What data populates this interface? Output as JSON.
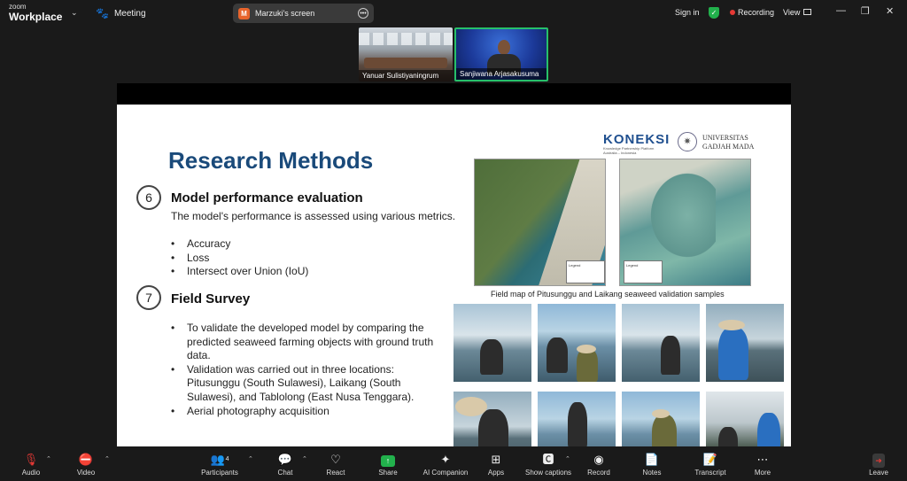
{
  "app": {
    "brand_small": "zoom",
    "brand_big": "Workplace",
    "meeting_label": "Meeting",
    "screen_share_label": "Marzuki's screen",
    "screen_share_avatar": "M",
    "sign_in": "Sign in",
    "recording": "Recording",
    "view": "View"
  },
  "participants": [
    {
      "name": "Yanuar Sulistiyaningrum"
    },
    {
      "name": "Sanjiwana Arjasakusuma"
    }
  ],
  "slide": {
    "title": "Research Methods",
    "logo_koneksi": "KONEKSI",
    "logo_koneksi_sub": "Knowledge Partnership Platform Australia – Indonesia",
    "logo_ugm_line1": "UNIVERSITAS",
    "logo_ugm_line2": "GADJAH MADA",
    "section6": {
      "number": "6",
      "heading": "Model performance evaluation",
      "text": "The model's performance is assessed using various metrics.",
      "bullets": [
        "Accuracy",
        "Loss",
        "Intersect over Union (IoU)"
      ]
    },
    "section7": {
      "number": "7",
      "heading": "Field Survey",
      "bullets": [
        "To validate the developed model by comparing the predicted seaweed farming objects with ground truth data.",
        "Validation was carried out in three locations: Pitusunggu (South Sulawesi), Laikang (South Sulawesi), and Tablolong (East Nusa Tenggara).",
        "Aerial photography acquisition"
      ]
    },
    "map_caption": "Field map of Pitusunggu and Laikang seaweed validation samples",
    "legend_title": "Legend"
  },
  "toolbar": {
    "audio": "Audio",
    "video": "Video",
    "participants": "Participants",
    "participants_count": "4",
    "chat": "Chat",
    "react": "React",
    "share": "Share",
    "ai_companion": "AI Companion",
    "apps": "Apps",
    "show_captions": "Show captions",
    "record": "Record",
    "notes": "Notes",
    "transcript": "Transcript",
    "more": "More",
    "leave": "Leave"
  },
  "colors": {
    "accent_green": "#22b14c",
    "recording_red": "#e53935",
    "slide_title_blue": "#1a4a7a"
  }
}
